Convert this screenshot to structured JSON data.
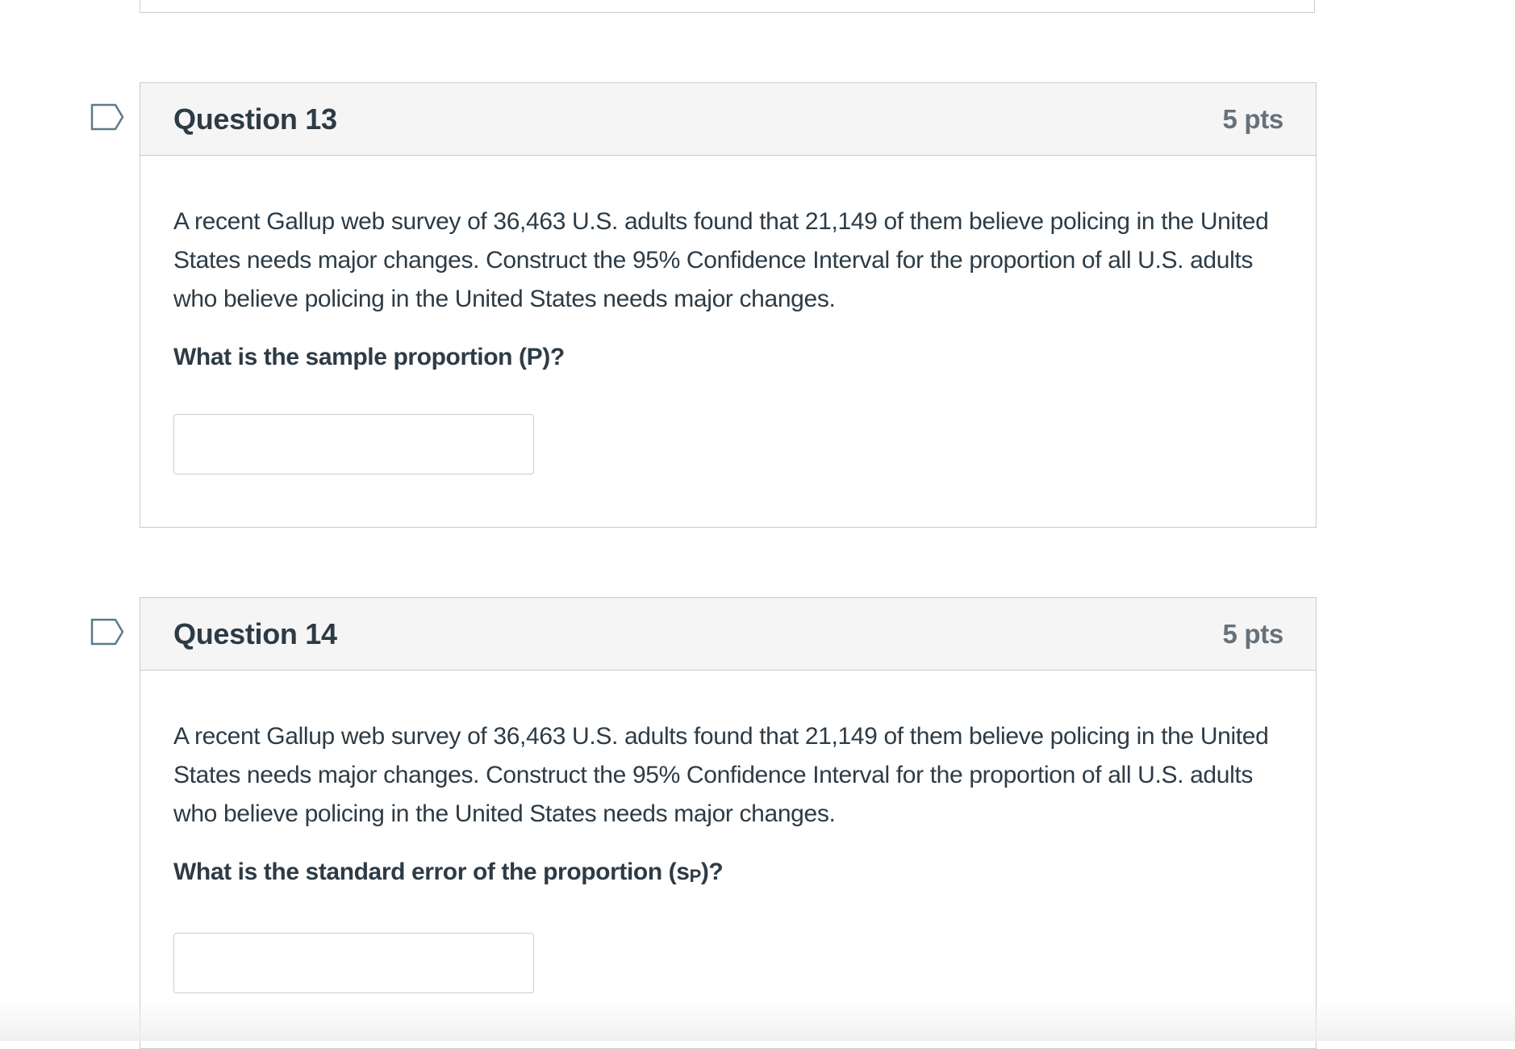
{
  "questions": [
    {
      "title": "Question 13",
      "points": "5 pts",
      "text": "A recent Gallup web survey of 36,463 U.S. adults found that 21,149 of them believe policing in the United States needs major changes. Construct the 95% Confidence Interval for the proportion of all U.S. adults who believe policing in the United States needs major changes.",
      "prompt": "What is the sample proportion (P)?",
      "answer_value": ""
    },
    {
      "title": "Question 14",
      "points": "5 pts",
      "text": "A recent Gallup web survey of 36,463 U.S. adults found that 21,149 of them believe policing in the United States needs major changes. Construct the 95% Confidence Interval for the proportion of all U.S. adults who believe policing in the United States needs major changes.",
      "prompt_main": "What is the standard error of the proportion (s",
      "prompt_sub": "P",
      "prompt_end": ")?",
      "answer_value": ""
    }
  ],
  "icons": {
    "flag": "flag-question-icon"
  },
  "colors": {
    "border": "#c7cdd1",
    "header_bg": "#f5f5f5",
    "text": "#2d3b45",
    "points": "#66727b",
    "flag": "#5b7a8c"
  }
}
